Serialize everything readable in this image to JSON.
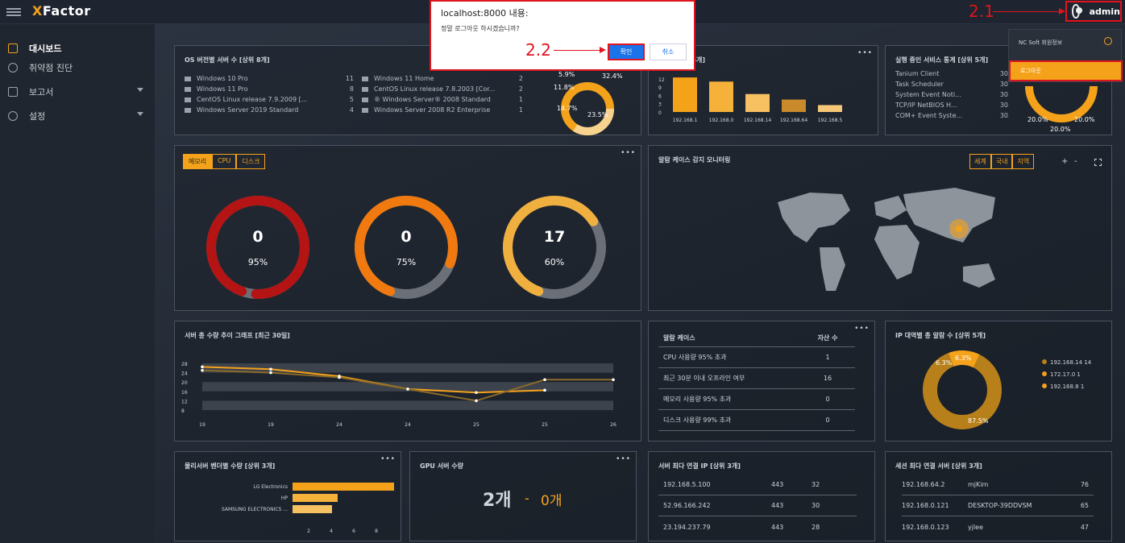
{
  "app": {
    "logo_x": "X",
    "logo_rest": "Factor",
    "user": "admin"
  },
  "annotations": {
    "a1": "2.1",
    "a2": "2.2"
  },
  "sidebar": {
    "items": [
      {
        "label": "대시보드",
        "icon": "dashboard-icon"
      },
      {
        "label": "취약점 진단",
        "icon": "target-icon"
      },
      {
        "label": "보고서",
        "icon": "folder-icon"
      },
      {
        "label": "설정",
        "icon": "gear-icon"
      }
    ]
  },
  "dialog": {
    "title": "localhost:8000 내용:",
    "message": "정말 로그아웃 하시겠습니까?",
    "ok": "확인",
    "cancel": "취소"
  },
  "user_menu": {
    "profile": "NC Soft 회원정보",
    "logout": "로그아웃"
  },
  "os_panel": {
    "title": "OS 버전별 서버 수 [상위 8개]",
    "left": [
      {
        "name": "Windows 10 Pro",
        "count": "11"
      },
      {
        "name": "Windows 11 Pro",
        "count": "8"
      },
      {
        "name": "CentOS Linux release 7.9.2009 [...",
        "count": "5"
      },
      {
        "name": "Windows Server 2019 Standard",
        "count": "4"
      }
    ],
    "right": [
      {
        "name": "Windows 11 Home",
        "count": "2"
      },
      {
        "name": "CentOS Linux release 7.8.2003 [Cor...",
        "count": "2"
      },
      {
        "name": "® Windows Server® 2008 Standard",
        "count": "1"
      },
      {
        "name": "Windows Server 2008 R2 Enterprise",
        "count": "1"
      }
    ],
    "donut_labels": [
      "5.9%",
      "11.8%",
      "14.7%",
      "23.5%",
      "32.4%"
    ]
  },
  "ip_panel": {
    "title": "버 수 [상위 5개]"
  },
  "service_panel": {
    "title": "실행 중인 서비스 통계 [상위 5개]",
    "rows": [
      {
        "name": "Tanium Client",
        "count": "30"
      },
      {
        "name": "Task Scheduler",
        "count": "30"
      },
      {
        "name": "System Event Noti...",
        "count": "30"
      },
      {
        "name": "TCP/IP NetBIOS H...",
        "count": "30"
      },
      {
        "name": "COM+ Event Syste...",
        "count": "30"
      }
    ],
    "donut_labels": [
      "20.0%",
      "20.0%",
      "20.0%"
    ]
  },
  "resource_panel": {
    "tabs": [
      "메모리",
      "CPU",
      "디스크"
    ],
    "gauges": [
      {
        "value": "0",
        "pct": "95%",
        "fill": 0.95,
        "color": "#b41414"
      },
      {
        "value": "0",
        "pct": "75%",
        "fill": 0.75,
        "color": "#f07a10"
      },
      {
        "value": "17",
        "pct": "60%",
        "fill": 0.6,
        "color": "#f0b040"
      }
    ]
  },
  "map_panel": {
    "title": "알람 케이스 감지 모니터링",
    "buttons": [
      "세계",
      "국내",
      "지역"
    ],
    "zoom_in": "+",
    "zoom_out": "-"
  },
  "trend_panel": {
    "title": "서버 총 수량 추이 그래프 [최근 30일]"
  },
  "alarm_panel": {
    "headers": [
      "알람 케이스",
      "자산 수"
    ],
    "rows": [
      {
        "name": "CPU 사용량 95% 초과",
        "count": "1"
      },
      {
        "name": "최근 30분 이내 오프라인 여부",
        "count": "16"
      },
      {
        "name": "메모리 사용량 95% 초과",
        "count": "0"
      },
      {
        "name": "디스크 사용량 99% 초과",
        "count": "0"
      }
    ]
  },
  "ip_alarm_panel": {
    "title": "IP 대역별 총 알람 수 [상위 5개]",
    "legend": [
      {
        "ip": "192.168.14",
        "count": "14",
        "color": "#b8801a"
      },
      {
        "ip": "172.17.0",
        "count": "1",
        "color": "#f0a020"
      },
      {
        "ip": "192.168.8",
        "count": "1",
        "color": "#f5a21b"
      }
    ],
    "donut_labels": [
      "6.3%",
      "6.3%",
      "87.5%"
    ]
  },
  "vendor_panel": {
    "title": "물리서버 벤더별 수량 [상위 3개]"
  },
  "gpu_panel": {
    "title": "GPU 서버 수량",
    "count": "2개",
    "sep": "-",
    "zero": "0개"
  },
  "conn_ip_panel": {
    "title": "서버 최다 연결 IP [상위 3개]",
    "rows": [
      {
        "ip": "192.168.5.100",
        "port": "443",
        "count": "32"
      },
      {
        "ip": "52.96.166.242",
        "port": "443",
        "count": "30"
      },
      {
        "ip": "23.194.237.79",
        "port": "443",
        "count": "28"
      }
    ]
  },
  "session_panel": {
    "title": "세션 최다 연결 서버 [상위 3개]",
    "rows": [
      {
        "ip": "192.168.64.2",
        "user": "mjKim",
        "count": "76"
      },
      {
        "ip": "192.168.0.121",
        "user": "DESKTOP-39DDVSM",
        "count": "65"
      },
      {
        "ip": "192.168.0.123",
        "user": "yjlee",
        "count": "47"
      }
    ]
  },
  "chart_data": [
    {
      "type": "bar",
      "title": "",
      "categories": [
        "192.168.1",
        "192.168.0",
        "192.168.14",
        "192.168.64",
        "192.168.5"
      ],
      "values": [
        12.5,
        11,
        6.5,
        4.5,
        2.5
      ],
      "yticks": [
        "12",
        "9",
        "6",
        "3",
        "0"
      ],
      "ylim": [
        0,
        14
      ],
      "colors": [
        "#f5a21b",
        "#f5b13a",
        "#f7c060",
        "#c88a2a",
        "#f7c778"
      ]
    },
    {
      "type": "line",
      "xticks": [
        "19",
        "19",
        "24",
        "24",
        "25",
        "25",
        "26"
      ],
      "yticks": [
        "28",
        "24",
        "20",
        "16",
        "12",
        "8"
      ],
      "ylim": [
        8,
        28
      ],
      "series": [
        {
          "values": [
            26.5,
            25.5,
            22.5,
            17,
            15.5,
            16.5,
            null
          ]
        },
        {
          "values": [
            25,
            24,
            22,
            17,
            12,
            21,
            21
          ]
        }
      ]
    },
    {
      "type": "bar",
      "orientation": "horizontal",
      "categories": [
        "LG Electronics",
        "HP",
        "SAMSUNG ELECTRONICS ..."
      ],
      "values": [
        9,
        4,
        3.5
      ],
      "xticks": [
        "2",
        "4",
        "6",
        "8"
      ],
      "xlim": [
        0,
        9
      ],
      "colors": [
        "#f5a21b",
        "#f5b13a",
        "#f7c060"
      ]
    }
  ]
}
